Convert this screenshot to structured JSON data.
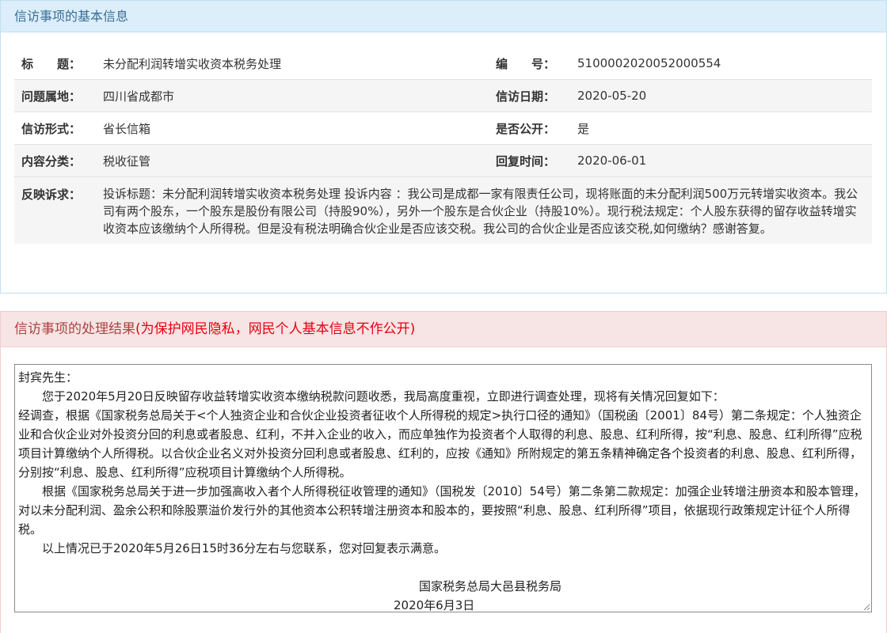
{
  "basic": {
    "header": "信访事项的基本信息",
    "title_label": "标　　题：",
    "title_value": "未分配利润转增实收资本税务处理",
    "number_label": "编　　号：",
    "number_value": "5100002020052000554",
    "location_label": "问题属地：",
    "location_value": "四川省成都市",
    "date_label": "信访日期：",
    "date_value": "2020-05-20",
    "form_label": "信访形式：",
    "form_value": "省长信箱",
    "public_label": "是否公开：",
    "public_value": "是",
    "category_label": "内容分类：",
    "category_value": "税收征管",
    "reply_time_label": "回复时间：",
    "reply_time_value": "2020-06-01",
    "appeal_label": "反映诉求：",
    "appeal_value": "投诉标题：未分配利润转增实收资本税务处理 投诉内容 ：我公司是成都一家有限责任公司，现将账面的未分配利润500万元转增实收资本。我公司有两个股东，一个股东是股份有限公司（持股90%），另外一个股东是合伙企业（持股10%）。现行税法规定：个人股东获得的留存收益转增实收资本应该缴纳个人所得税。但是没有税法明确合伙企业是否应该交税。我公司的合伙企业是否应该交税,如何缴纳？感谢答复。"
  },
  "result": {
    "header": "信访事项的处理结果",
    "privacy_note": "(为保护网民隐私，网民个人基本信息不作公开)",
    "paragraphs": [
      "封宾先生：",
      "　　您于2020年5月20日反映留存收益转增实收资本缴纳税款问题收悉，我局高度重视，立即进行调查处理，现将有关情况回复如下：",
      "经调查，根据《国家税务总局关于<个人独资企业和合伙企业投资者征收个人所得税的规定>执行口径的通知》（国税函〔2001〕84号）第二条规定：个人独资企业和合伙企业对外投资分回的利息或者股息、红利，不并入企业的收入，而应单独作为投资者个人取得的利息、股息、红利所得，按“利息、股息、红利所得”应税项目计算缴纳个人所得税。以合伙企业名义对外投资分回利息或者股息、红利的，应按《通知》所附规定的第五条精神确定各个投资者的利息、股息、红利所得，分别按“利息、股息、红利所得”应税项目计算缴纳个人所得税。",
      "　　根据《国家税务总局关于进一步加强高收入者个人所得税征收管理的通知》（国税发〔2010〕54号）第二条第二款规定：加强企业转增注册资本和股本管理，对以未分配利润、盈余公积和除股票溢价发行外的其他资本公积转增注册资本和股本的，要按照“利息、股息、红利所得”项目，依据现行政策规定计征个人所得税。",
      "　　以上情况已于2020年5月26日15时36分左右与您联系，您对回复表示满意。"
    ],
    "signature_org": "国家税务总局大邑县税务局",
    "signature_date": "2020年6月3日"
  }
}
